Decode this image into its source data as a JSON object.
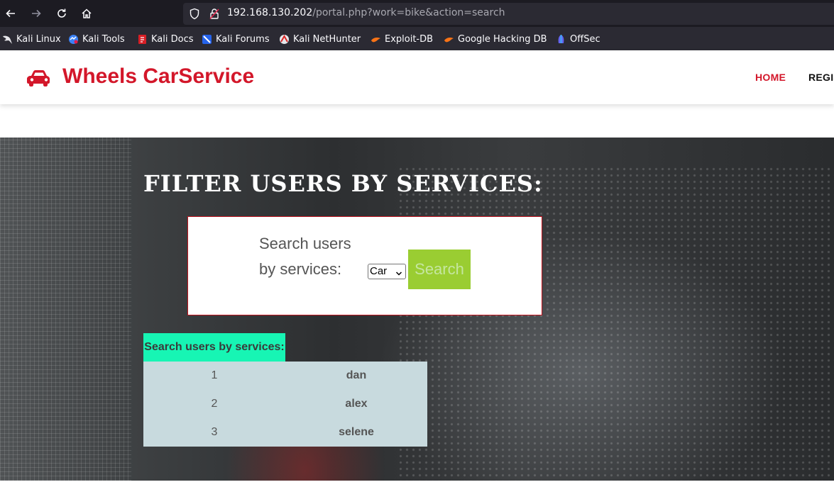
{
  "browser": {
    "url_host": "192.168.130.202",
    "url_path": "/portal.php?work=bike&action=search",
    "bookmarks": [
      {
        "label": "Kali Linux",
        "icon": "kali-dragon-icon"
      },
      {
        "label": "Kali Tools",
        "icon": "kali-tools-icon"
      },
      {
        "label": "Kali Docs",
        "icon": "kali-docs-icon"
      },
      {
        "label": "Kali Forums",
        "icon": "kali-forums-icon"
      },
      {
        "label": "Kali NetHunter",
        "icon": "kali-nethunter-icon"
      },
      {
        "label": "Exploit-DB",
        "icon": "exploit-db-icon"
      },
      {
        "label": "Google Hacking DB",
        "icon": "ghdb-icon"
      },
      {
        "label": "OffSec",
        "icon": "offsec-icon"
      }
    ]
  },
  "site": {
    "brand": "Wheels CarService",
    "brand_icon": "car-icon",
    "brand_color": "#d3172a",
    "nav": {
      "home": "HOME",
      "register": "REGIS"
    }
  },
  "hero": {
    "title": "FILTER USERS BY SERVICES:",
    "search_label_line1": "Search users",
    "search_label_line2": "by services:",
    "select_value": "Car",
    "search_button": "Search",
    "button_color": "#9acd32"
  },
  "results": {
    "header": "Search users by services:",
    "header_color": "#17f5b4",
    "rows": [
      {
        "id": "1",
        "name": "dan"
      },
      {
        "id": "2",
        "name": "alex"
      },
      {
        "id": "3",
        "name": "selene"
      }
    ]
  }
}
